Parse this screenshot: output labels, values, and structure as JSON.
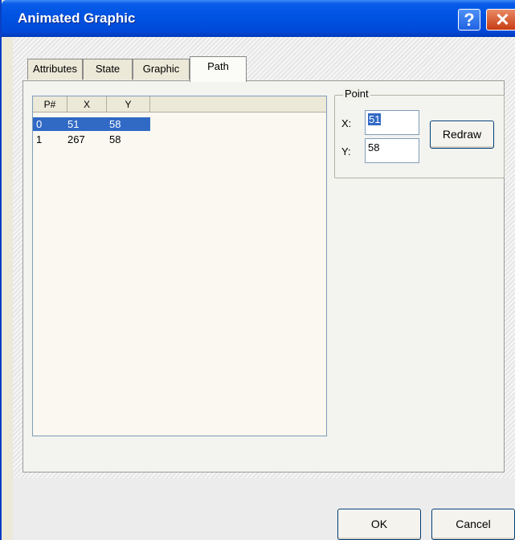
{
  "window": {
    "title": "Animated Graphic"
  },
  "titlebar_buttons": {
    "help": "?",
    "close": "✕"
  },
  "tabs": [
    {
      "label": "Attributes"
    },
    {
      "label": "State"
    },
    {
      "label": "Graphic"
    },
    {
      "label": "Path"
    }
  ],
  "active_tab": "Path",
  "list": {
    "columns": [
      "P#",
      "X",
      "Y"
    ],
    "rows": [
      {
        "p": "0",
        "x": "51",
        "y": "58",
        "selected": true
      },
      {
        "p": "1",
        "x": "267",
        "y": "58",
        "selected": false
      }
    ]
  },
  "point_group": {
    "label": "Point",
    "x_label": "X:",
    "x_value": "51",
    "y_label": "Y:",
    "y_value": "58",
    "redraw_label": "Redraw"
  },
  "footer": {
    "ok_label": "OK",
    "cancel_label": "Cancel"
  },
  "colors": {
    "titlebar": "#0054e3",
    "selection": "#316ac5"
  }
}
